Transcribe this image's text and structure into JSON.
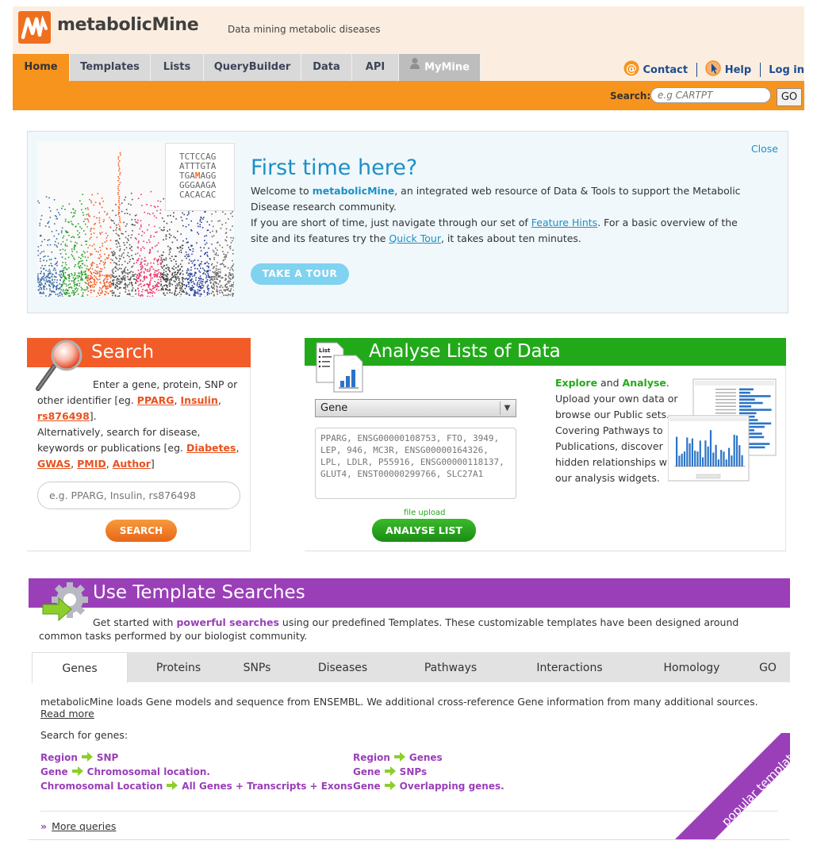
{
  "header": {
    "brand": "metabolicMine",
    "tagline": "Data mining metabolic diseases",
    "nav_tabs": [
      "Home",
      "Templates",
      "Lists",
      "QueryBuilder",
      "Data",
      "API",
      "MyMine"
    ],
    "links": {
      "contact": "Contact",
      "help": "Help",
      "login": "Log in"
    },
    "search_label": "Search:",
    "search_placeholder": "e.g CARTPT",
    "go_label": "GO"
  },
  "welcome": {
    "sequence": [
      "TCTCCAG",
      "ATTTGTA",
      "TGAMAGG",
      "GGGAAGA",
      "CACACAC"
    ],
    "title": "First time here?",
    "p1_pre": "Welcome to ",
    "p1_brand": "metabolicMine",
    "p1_post": ", an integrated web resource of Data & Tools to support the Metabolic Disease research community.",
    "p2_pre": "If you are short of time, just navigate through our set of ",
    "p2_link1": "Feature Hints",
    "p2_mid": ". For a basic overview of the site and its features try the ",
    "p2_link2": "Quick Tour",
    "p2_post": ", it takes about ten minutes.",
    "close": "Close",
    "tour_button": "TAKE A TOUR"
  },
  "search_panel": {
    "title": "Search",
    "t1": "Enter a gene, protein, SNP or other identifier [eg. ",
    "ex1": "PPARG",
    "ex2": "Insulin",
    "ex3": "rs876498",
    "t2": "].",
    "t3": "Alternatively, search for disease, keywords or publications [eg. ",
    "ex4": "Diabetes",
    "ex5": "GWAS",
    "ex6": "PMID",
    "ex7": "Author",
    "t4": "]",
    "placeholder": "e.g. PPARG, Insulin, rs876498",
    "button": "SEARCH"
  },
  "lists_panel": {
    "title": "Analyse Lists of Data",
    "select_value": "Gene",
    "textarea_placeholder": "PPARG, ENSG00000108753, FTO, 3949, LEP, 946, MC3R, ENSG00000164326, LPL, LDLR, P55916, ENSG00000118137, GLUT4, ENST00000299766, SLC27A1",
    "file_upload": "file upload",
    "button": "ANALYSE LIST",
    "explore": "Explore",
    "and": " and ",
    "analyse": "Analyse",
    "desc": ". Upload your own data or browse our Public sets. Covering Pathways to Publications, discover hidden relationships with our analysis widgets."
  },
  "templates_panel": {
    "title": "Use Template Searches",
    "d1": "Get started with ",
    "d_bold": "powerful searches",
    "d2": " using our predefined Templates. These customizable templates have been designed around common tasks performed by our biologist community.",
    "tabs": [
      "Genes",
      "Proteins",
      "SNPs",
      "Diseases",
      "Pathways",
      "Interactions",
      "Homology",
      "GO"
    ],
    "content_text": "metabolicMine loads Gene models and sequence from ENSEMBL. We additional cross-reference Gene information from many additional sources. ",
    "read_more": "Read more",
    "search_for": "Search for genes:",
    "queries": [
      {
        "from": "Region",
        "to": "SNP"
      },
      {
        "from": "Gene",
        "to": "Chromosomal location."
      },
      {
        "from": "Chromosomal Location",
        "to": "All Genes + Transcripts + Exons"
      },
      {
        "from": "Region",
        "to": "Genes"
      },
      {
        "from": "Gene",
        "to": "SNPs"
      },
      {
        "from": "Gene",
        "to": "Overlapping genes."
      }
    ],
    "more_queries": "More queries",
    "ribbon": "popular templates"
  },
  "colors": {
    "orange": "#f7941d",
    "search_red": "#f25c29",
    "green": "#22a91a",
    "purple": "#9a3fb8",
    "blue": "#1d8fc4"
  }
}
